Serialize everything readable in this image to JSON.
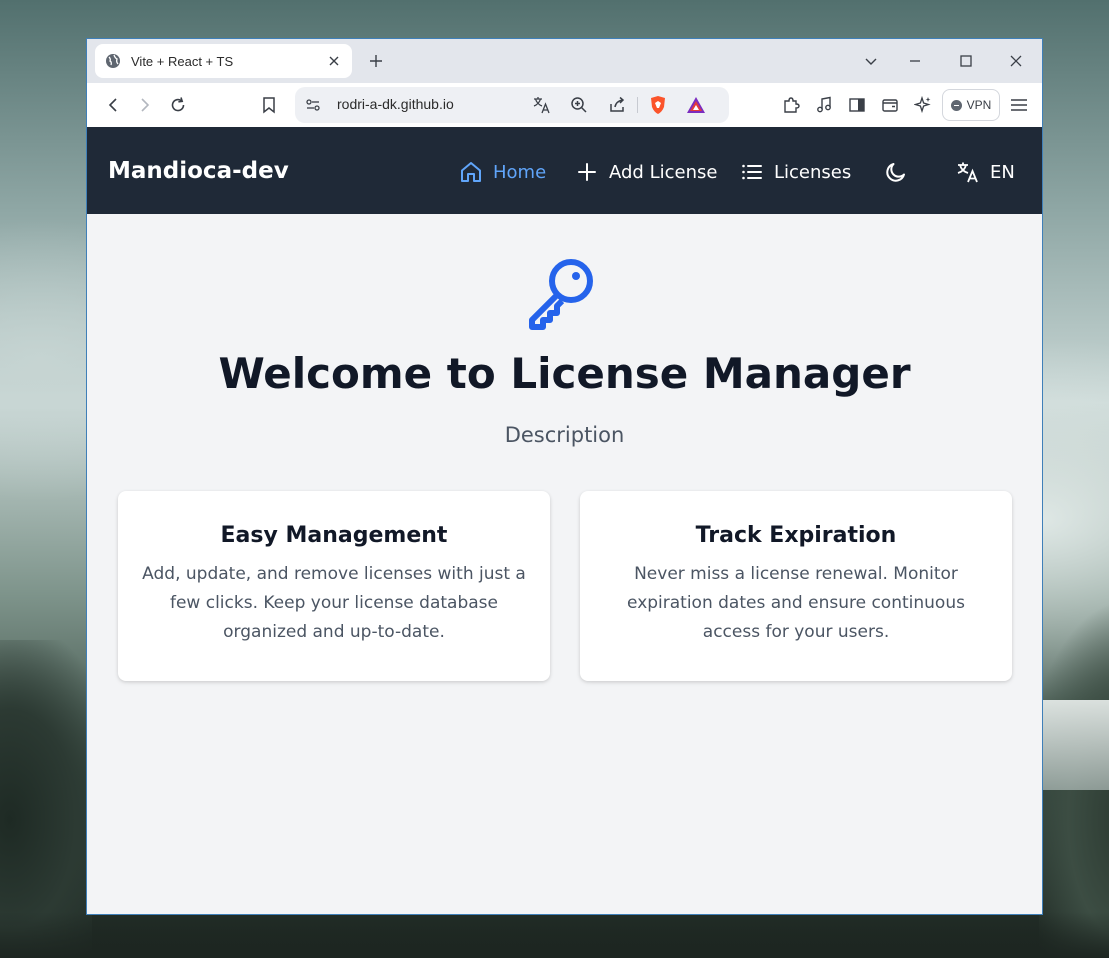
{
  "browser": {
    "tab": {
      "title": "Vite + React + TS"
    },
    "address_bar": {
      "url": "rodri-a-dk.github.io"
    },
    "vpn_label": "VPN"
  },
  "app": {
    "brand": "Mandioca-dev",
    "nav": [
      {
        "label": "Home",
        "icon": "home-icon",
        "active": true
      },
      {
        "label": "Add License",
        "icon": "plus-icon",
        "active": false
      },
      {
        "label": "Licenses",
        "icon": "list-icon",
        "active": false
      }
    ],
    "language": "EN",
    "hero": {
      "icon": "key-icon",
      "title": "Welcome to License Manager",
      "description": "Description"
    },
    "features": [
      {
        "title": "Easy Management",
        "text": "Add, update, and remove licenses with just a few clicks. Keep your license database organized and up-to-date."
      },
      {
        "title": "Track Expiration",
        "text": "Never miss a license renewal. Monitor expiration dates and ensure continuous access for your users."
      }
    ]
  },
  "colors": {
    "navbar": "#1f2937",
    "accent": "#2563eb",
    "active_nav": "#60a5fa",
    "page_bg": "#f3f4f6"
  }
}
